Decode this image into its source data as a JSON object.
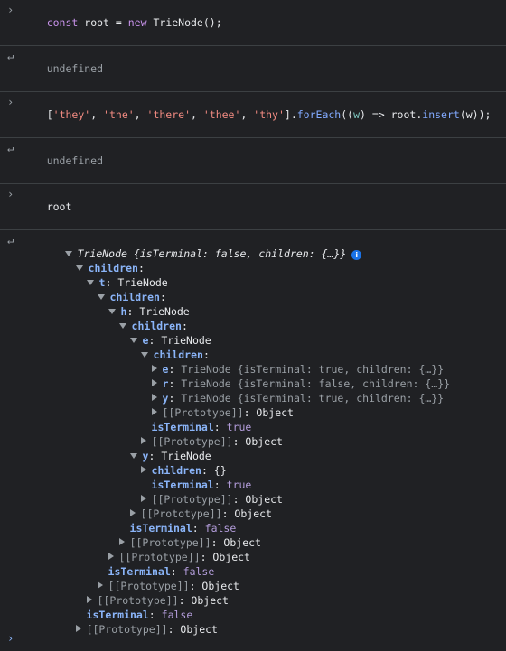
{
  "entries": [
    {
      "type": "input",
      "text": "const root = new TrieNode();"
    },
    {
      "type": "output",
      "text": "undefined"
    },
    {
      "type": "input",
      "text": "['they', 'the', 'there', 'thee', 'thy'].forEach((w) => root.insert(w));"
    },
    {
      "type": "output",
      "text": "undefined"
    },
    {
      "type": "input",
      "text": "root"
    }
  ],
  "icons": {
    "input_prompt": "chevron-right-icon",
    "output_return": "return-arrow-icon",
    "expand": "triangle-right-icon",
    "collapse": "triangle-down-icon",
    "info": "info-icon"
  },
  "tree": {
    "root_summary": "TrieNode {isTerminal: false, children: {…}}",
    "info": "i",
    "labels": {
      "children": "children",
      "isTerminal": "isTerminal",
      "prototype": "[[Prototype]]",
      "object": "Object",
      "trienode": "TrieNode",
      "true": "true",
      "false": "false",
      "empty_obj": "{}"
    },
    "keys": {
      "t": "t",
      "h": "h",
      "e": "e",
      "r": "r",
      "y": "y"
    },
    "summaries": {
      "e_leaf": "TrieNode {isTerminal: true, children: {…}}",
      "r_leaf": "TrieNode {isTerminal: false, children: {…}}",
      "y_leaf": "TrieNode {isTerminal: true, children: {…}}"
    }
  },
  "colors": {
    "background": "#202124",
    "key": "#8ab4f8",
    "boolean": "#b39ddb",
    "string": "#f28b82",
    "keyword": "#c792ea"
  }
}
